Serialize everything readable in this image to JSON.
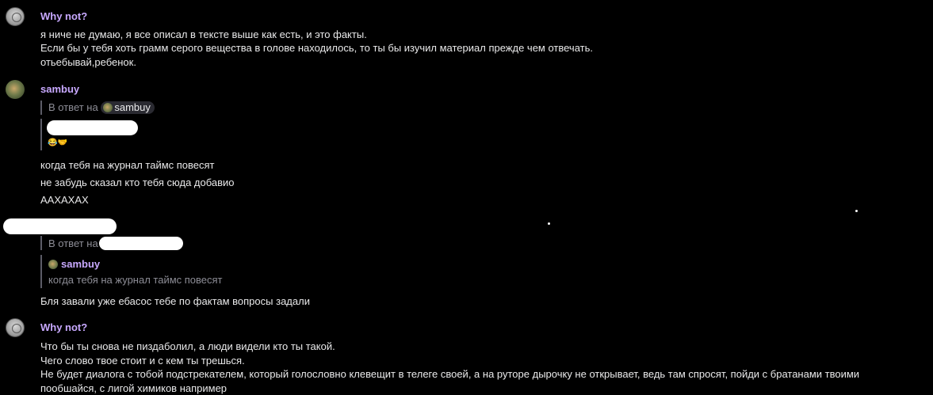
{
  "messages": [
    {
      "author": "Why not?",
      "lines": [
        "я ниче не думаю, я все описал в тексте выше как есть, и это факты.",
        "Если бы у тебя хоть грамм серого вещества в голове находилось, то ты бы изучил материал прежде чем отвечать.",
        "отьебывай,ребенок."
      ]
    },
    {
      "author": "sambuy",
      "reply_label": "В ответ на",
      "reply_user": "sambuy",
      "reply_emoji": "😂🤝",
      "lines": [
        "когда тебя на журнал таймс повесят",
        "не забудь сказал кто тебя сюда добавио",
        "ААХАХАХ"
      ]
    },
    {
      "reply_label": "В ответ на",
      "quote_author": "sambuy",
      "quote_text": "когда тебя на журнал таймс повесят",
      "lines": [
        "Бля завали уже ебасос тебе по фактам вопросы задали"
      ]
    },
    {
      "author": "Why not?",
      "lines": [
        "Что бы ты снова не пиздаболил, а люди видели кто ты такой.",
        "Чего слово твое стоит и с кем ты трешься.",
        "Не будет диалога с  тобой подстрекателем, который голословно клевещит в телеге своей, а на руторе дырочку не открывает, ведь там спросят, пойди с братанами твоими",
        "пообшайся, с лигой химиков например"
      ]
    }
  ]
}
